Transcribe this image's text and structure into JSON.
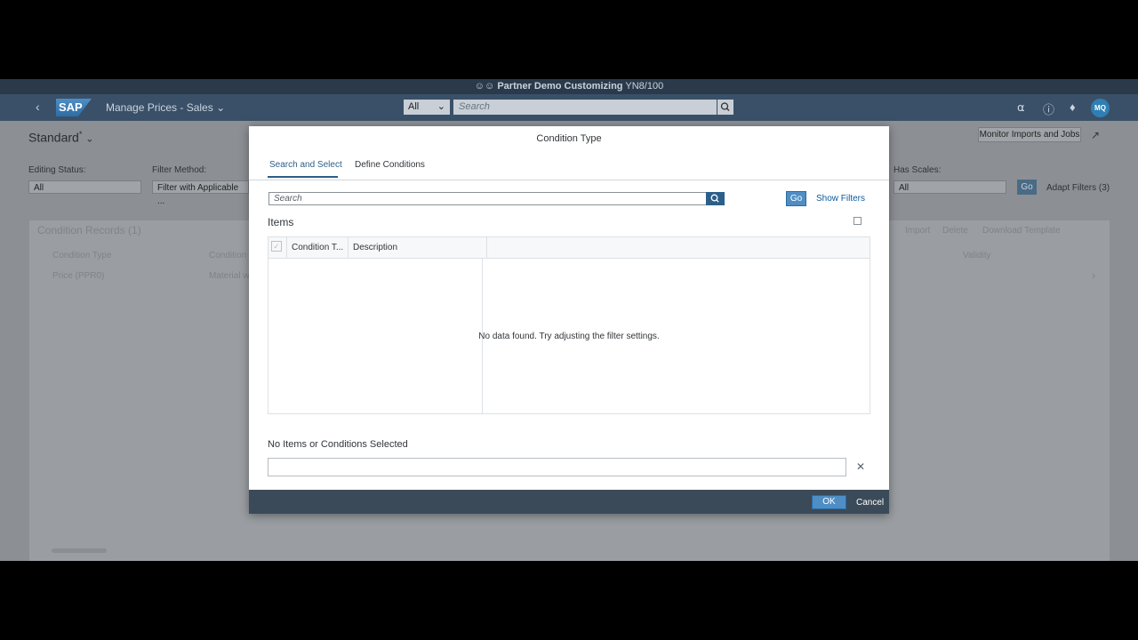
{
  "system_bar": {
    "client_name": "Partner Demo Customizing",
    "system_id": "YN8/100"
  },
  "shell": {
    "logo": "SAP",
    "app_title": "Manage Prices - Sales",
    "scope": "All",
    "search_placeholder": "Search",
    "avatar_initials": "MQ"
  },
  "page": {
    "variant": "Standard",
    "variant_marker": "*",
    "monitor_button": "Monitor Imports and Jobs",
    "filters": {
      "editing_status": {
        "label": "Editing Status:",
        "value": "All"
      },
      "filter_method": {
        "label": "Filter Method:",
        "value": "Filter with Applicable ..."
      },
      "has_scales": {
        "label": "Has Scales:",
        "value": "All"
      }
    },
    "go_label": "Go",
    "adapt_filters": "Adapt Filters (3)",
    "table": {
      "title": "Condition Records (1)",
      "actions": [
        "Import",
        "Delete",
        "Download Template"
      ],
      "columns": [
        "Condition Type",
        "Condition",
        "Validity"
      ],
      "first_row": [
        "Price (PPR0)",
        "Material wi..."
      ]
    }
  },
  "dialog": {
    "title": "Condition Type",
    "tabs": [
      "Search and Select",
      "Define Conditions"
    ],
    "search_placeholder": "Search",
    "go_label": "Go",
    "show_filters": "Show Filters",
    "items_title": "Items",
    "columns": [
      "Condition T...",
      "Description"
    ],
    "no_data": "No data found. Try adjusting the filter settings.",
    "selection_title": "No Items or Conditions Selected",
    "ok_label": "OK",
    "cancel_label": "Cancel"
  },
  "colors": {
    "accent": "#2b5f8a",
    "button": "#4f8ec4",
    "shell": "#3a5068",
    "footer": "#3b4a58"
  }
}
